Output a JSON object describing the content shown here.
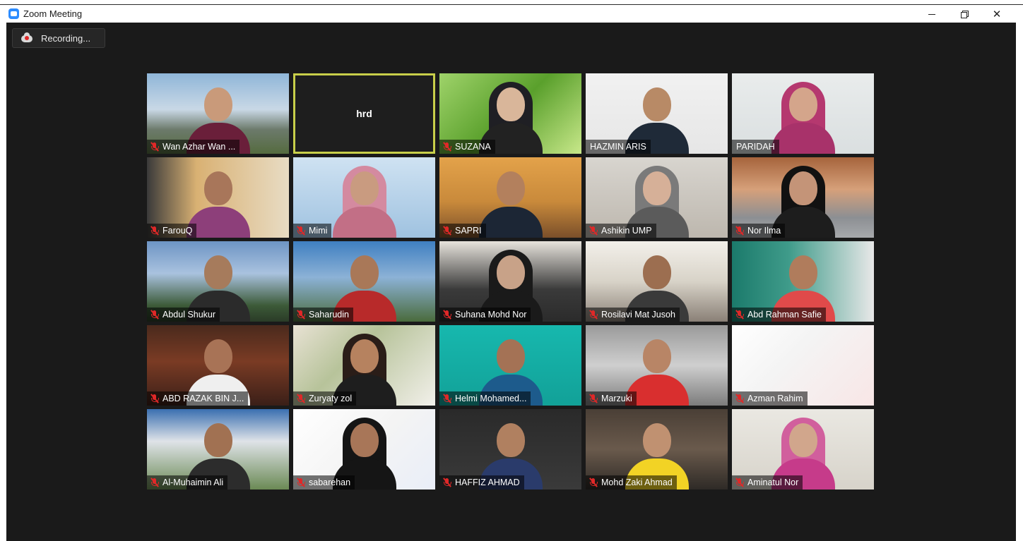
{
  "window": {
    "title": "Zoom Meeting",
    "minimize_icon": "minimize-icon",
    "restore_icon": "restore-icon",
    "close_icon": "close-icon"
  },
  "recording": {
    "label": "Recording...",
    "icon": "cloud-record-icon"
  },
  "participants": [
    {
      "name": "Wan Azhar Wan ...",
      "muted": true
    },
    {
      "name": "hrd",
      "video": false,
      "active_speaker": true
    },
    {
      "name": "SUZANA",
      "muted": true
    },
    {
      "name": "HAZMIN ARIS",
      "muted": false
    },
    {
      "name": "PARIDAH",
      "muted": false
    },
    {
      "name": "FarouQ",
      "muted": true
    },
    {
      "name": "Mimi",
      "muted": true
    },
    {
      "name": "SAPRI",
      "muted": true
    },
    {
      "name": "Ashikin UMP",
      "muted": true
    },
    {
      "name": "Nor Ilma",
      "muted": true
    },
    {
      "name": "Abdul Shukur",
      "muted": true
    },
    {
      "name": "Saharudin",
      "muted": true
    },
    {
      "name": "Suhana Mohd Nor",
      "muted": true
    },
    {
      "name": "Rosilavi Mat Jusoh",
      "muted": true
    },
    {
      "name": "Abd Rahman Safie",
      "muted": true
    },
    {
      "name": "ABD RAZAK BIN J...",
      "muted": true
    },
    {
      "name": "Zuryaty zol",
      "muted": true
    },
    {
      "name": "Helmi Mohamed...",
      "muted": true
    },
    {
      "name": "Marzuki",
      "muted": true
    },
    {
      "name": "Azman Rahim",
      "muted": true
    },
    {
      "name": "Al-Muhaimin Ali",
      "muted": true
    },
    {
      "name": "sabarehan",
      "muted": true
    },
    {
      "name": "HAFFIZ AHMAD",
      "muted": true
    },
    {
      "name": "Mohd Zaki Ahmad",
      "muted": true
    },
    {
      "name": "Aminatul Nor",
      "muted": true
    }
  ],
  "colors": {
    "stage_bg": "#1a1a1a",
    "active_border": "#c8cf4a",
    "muted_red": "#e02828",
    "zoom_blue": "#2d8cff"
  }
}
